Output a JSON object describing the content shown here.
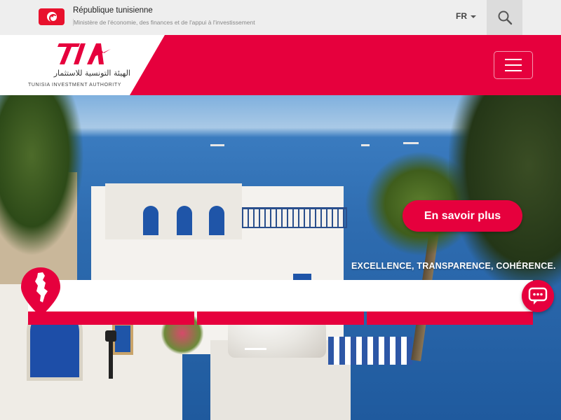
{
  "topbar": {
    "gov_title": "République tunisienne",
    "gov_subtitle": "Ministère de l'économie, des finances et de l'appui à l'investissement",
    "language": "FR",
    "icons": {
      "flag": "tunisia-flag-icon",
      "search": "search-icon"
    }
  },
  "header": {
    "logo_mark": "TIA",
    "logo_arabic": "الهيئة التونسية للاستثمار",
    "logo_english": "TUNISIA INVESTMENT AUTHORITY",
    "brand_color": "#e6003d",
    "icons": {
      "menu": "hamburger-menu-icon"
    }
  },
  "hero": {
    "cta_label": "En savoir plus",
    "tagline": "EXCELLENCE, TRANSPARENCE, COHÉRENCE.",
    "slide_indicator": "1"
  },
  "widgets": {
    "icons": {
      "map": "tunisia-map-pin-icon",
      "chat": "chat-bubble-icon"
    }
  },
  "colors": {
    "accent": "#e6003d",
    "topbar_bg": "#eeeeee",
    "search_bg": "#dcdcdc"
  }
}
